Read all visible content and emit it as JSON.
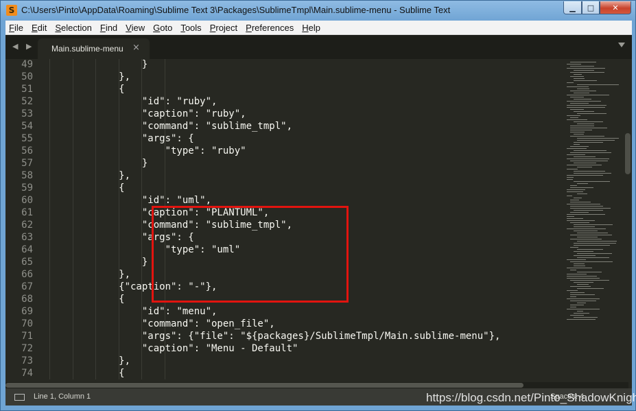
{
  "window": {
    "title": "C:\\Users\\Pinto\\AppData\\Roaming\\Sublime Text 3\\Packages\\SublimeTmpl\\Main.sublime-menu - Sublime Text",
    "app_icon_letter": "S",
    "min_label": "▁",
    "max_label": "□",
    "close_label": "✕"
  },
  "menubar": {
    "items": [
      {
        "first": "F",
        "rest": "ile"
      },
      {
        "first": "E",
        "rest": "dit"
      },
      {
        "first": "S",
        "rest": "election"
      },
      {
        "first": "F",
        "rest": "ind"
      },
      {
        "first": "V",
        "rest": "iew"
      },
      {
        "first": "G",
        "rest": "oto"
      },
      {
        "first": "T",
        "rest": "ools"
      },
      {
        "first": "P",
        "rest": "roject"
      },
      {
        "first": "P",
        "rest": "references"
      },
      {
        "first": "H",
        "rest": "elp"
      }
    ]
  },
  "tabs": {
    "nav_label": "◀ ▶",
    "active": {
      "label": "Main.sublime-menu",
      "close": "×"
    }
  },
  "editor": {
    "line_numbers": [
      "49",
      "50",
      "51",
      "52",
      "53",
      "54",
      "55",
      "56",
      "57",
      "58",
      "59",
      "60",
      "61",
      "62",
      "63",
      "64",
      "65",
      "66",
      "67",
      "68",
      "69",
      "70",
      "71",
      "72",
      "73",
      "74"
    ],
    "lines": [
      "                }",
      "            },",
      "            {",
      "                \"id\": \"ruby\",",
      "                \"caption\": \"ruby\",",
      "                \"command\": \"sublime_tmpl\",",
      "                \"args\": {",
      "                    \"type\": \"ruby\"",
      "                }",
      "            },",
      "            {",
      "                \"id\": \"uml\",",
      "                \"caption\": \"PLANTUML\",",
      "                \"command\": \"sublime_tmpl\",",
      "                \"args\": {",
      "                    \"type\": \"uml\"",
      "                }",
      "            },",
      "            {\"caption\": \"-\"},",
      "            {",
      "                \"id\": \"menu\",",
      "                \"command\": \"open_file\",",
      "                \"args\": {\"file\": \"${packages}/SublimeTmpl/Main.sublime-menu\"},",
      "                \"caption\": \"Menu - Default\"",
      "            },",
      "            {"
    ]
  },
  "statusbar": {
    "position": "Line 1, Column 1",
    "right_text": "Spaces: 4"
  },
  "watermark": "https://blog.csdn.net/Pinto_ShadowKnight"
}
